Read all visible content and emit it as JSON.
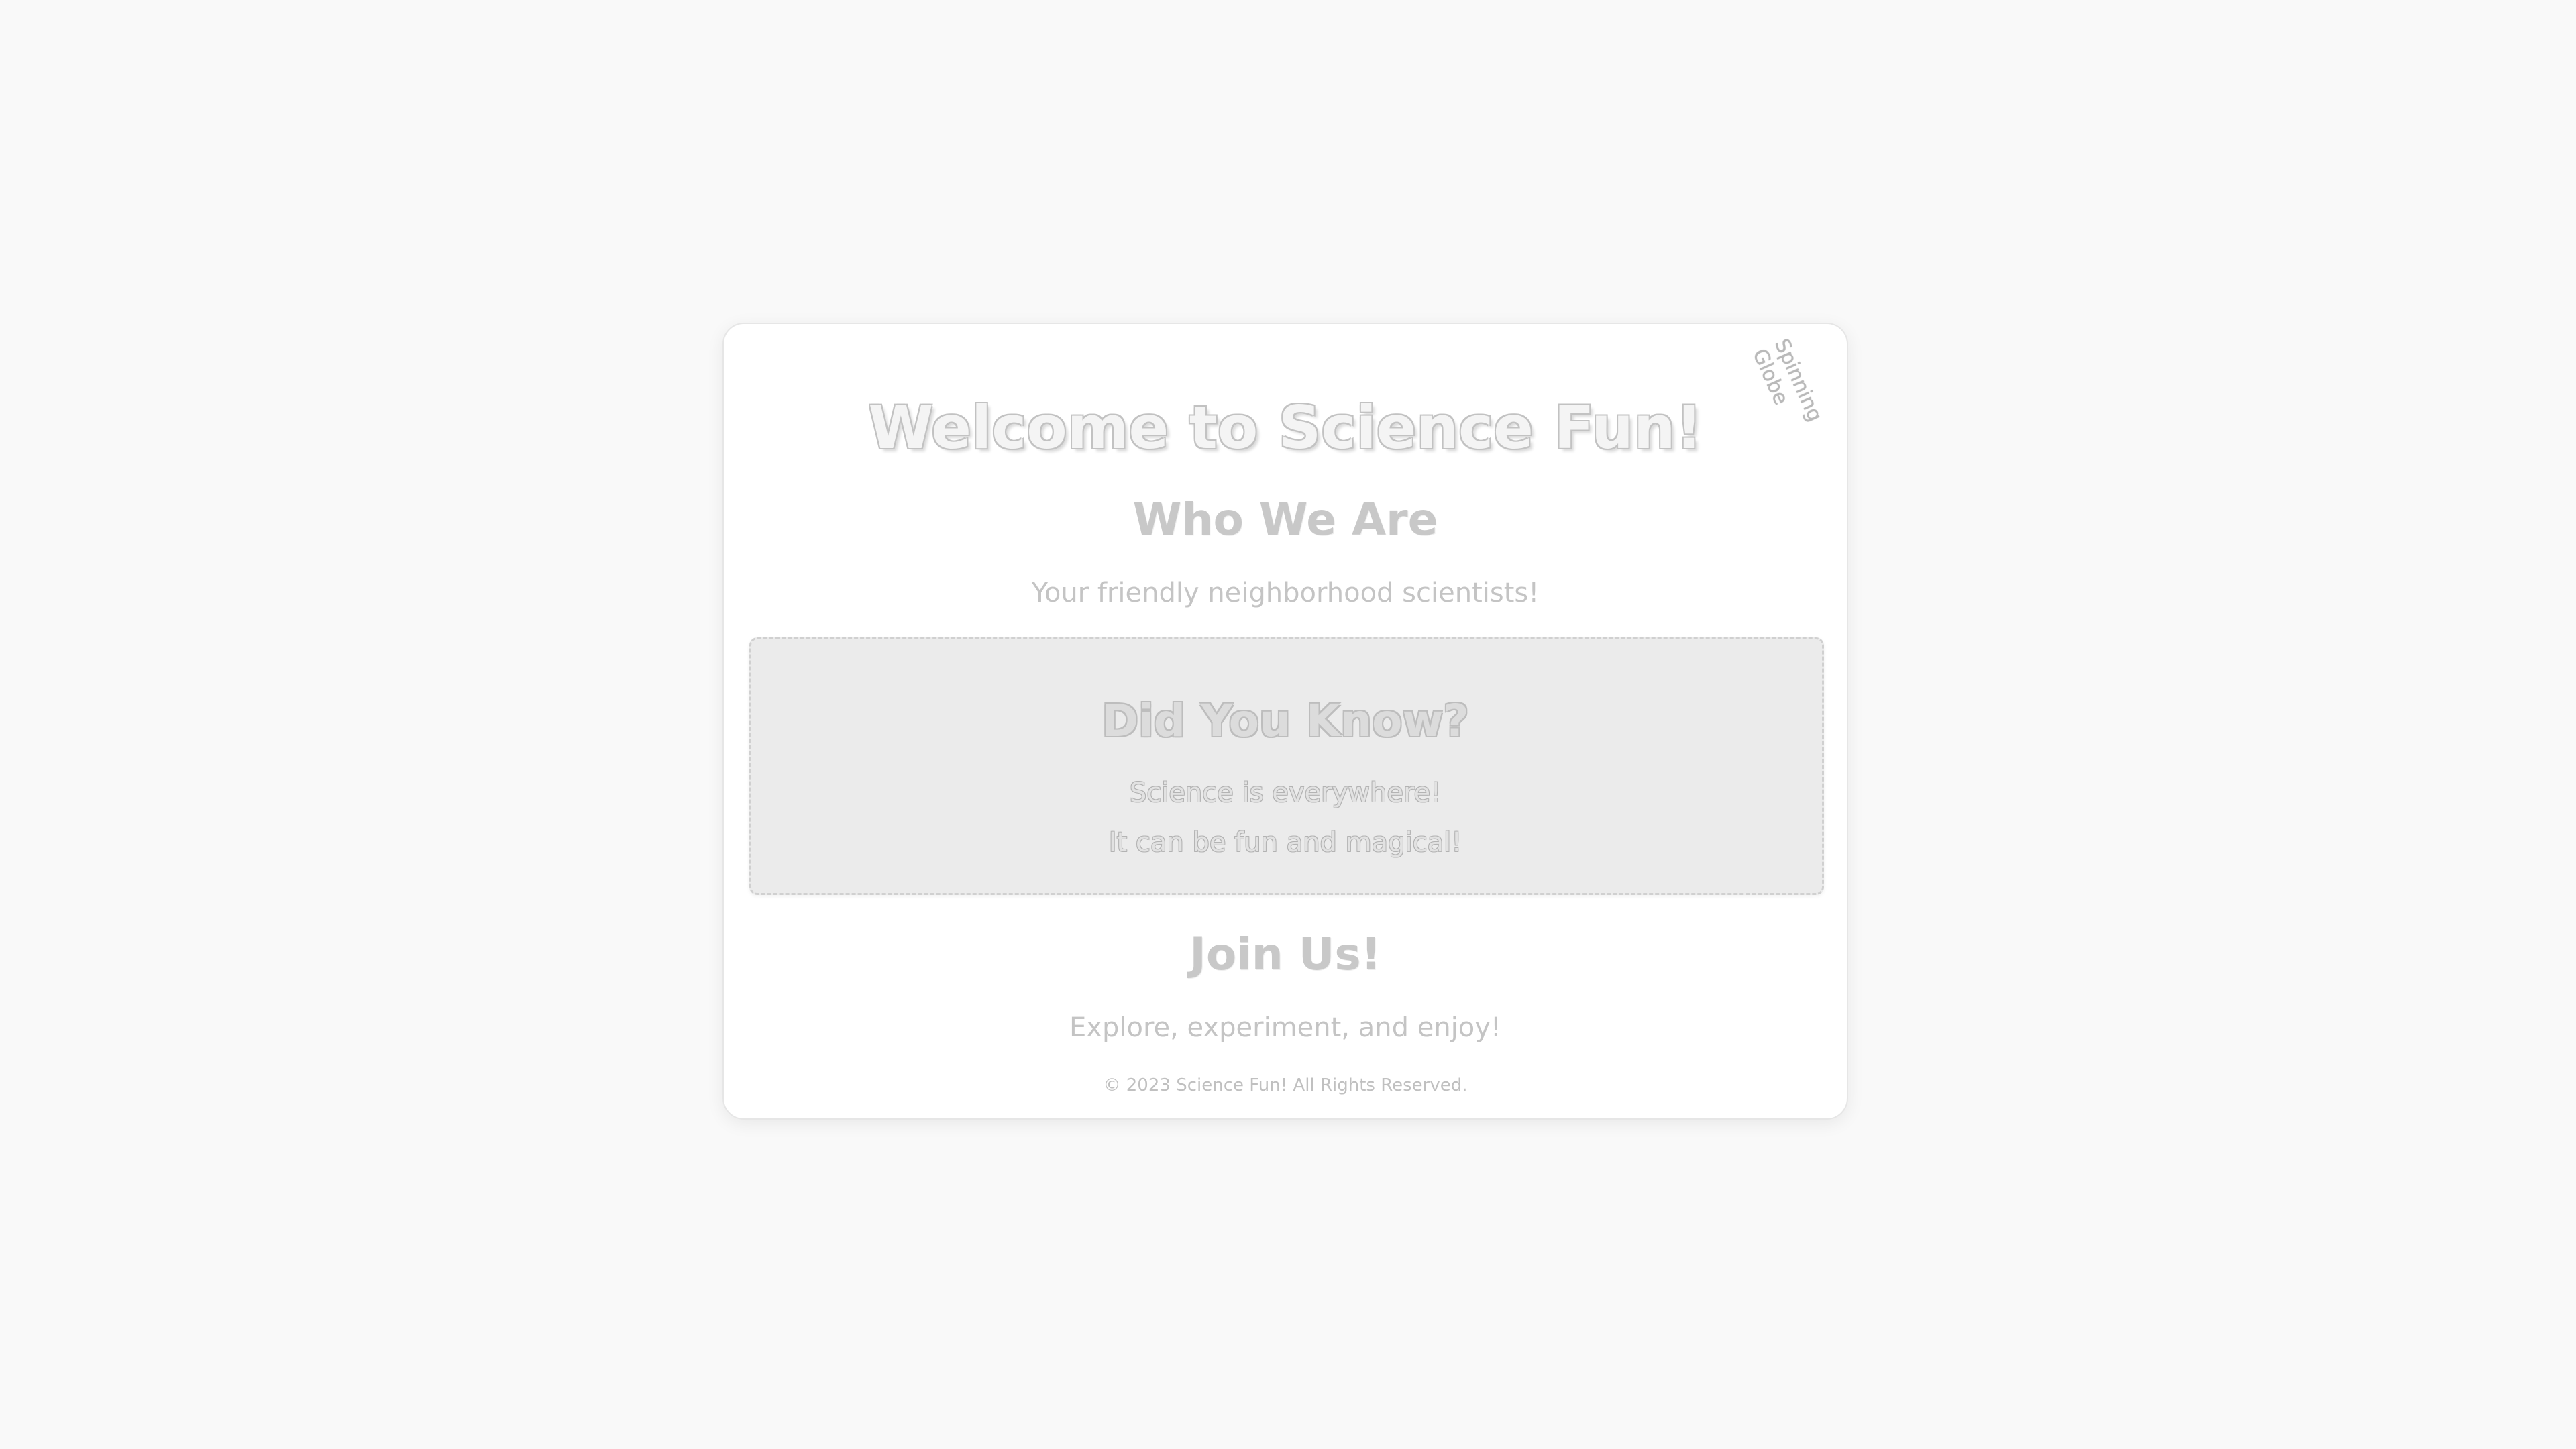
{
  "page": {
    "globe_label": "Spinning Globe",
    "title": "Welcome to Science Fun!",
    "about": {
      "heading": "Who We Are",
      "text": "Your friendly neighborhood scientists!"
    },
    "fact_box": {
      "heading": "Did You Know?",
      "line1": "Science is everywhere!",
      "line2": "It can be fun and magical!"
    },
    "join": {
      "heading": "Join Us!",
      "text": "Explore, experiment, and enjoy!"
    },
    "footer": "© 2023 Science Fun! All Rights Reserved."
  }
}
